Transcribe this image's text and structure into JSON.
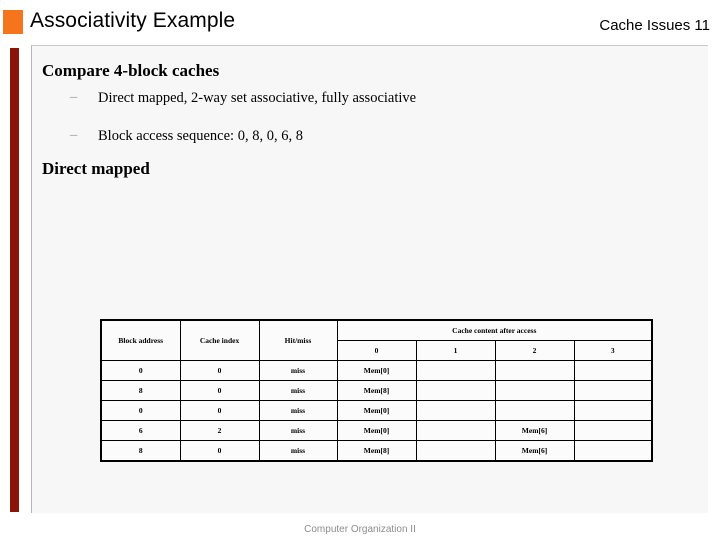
{
  "header": {
    "title": "Associativity Example",
    "right_label": "Cache Issues 11",
    "accent_color": "#f4751b",
    "bar_color": "#8a1408"
  },
  "body": {
    "heading_1": "Compare 4-block caches",
    "bullets": [
      {
        "marker": "–",
        "text": "Direct mapped, 2-way set associative, fully associative"
      },
      {
        "marker": "–",
        "text": "Block access sequence: 0, 8, 0, 6, 8"
      }
    ],
    "heading_2": "Direct mapped"
  },
  "table": {
    "headers": {
      "block_address": "Block address",
      "cache_index": "Cache index",
      "hit_miss": "Hit/miss",
      "cache_content": "Cache content after access"
    },
    "subheaders": [
      "0",
      "1",
      "2",
      "3"
    ],
    "rows": [
      {
        "block_address": "0",
        "cache_index": "0",
        "hit_miss": "miss",
        "content": [
          {
            "text": "Mem[0]",
            "style": "mem-gray"
          },
          {
            "text": "",
            "style": "cell-empty"
          },
          {
            "text": "",
            "style": "cell-empty"
          },
          {
            "text": "",
            "style": "cell-empty"
          }
        ]
      },
      {
        "block_address": "8",
        "cache_index": "0",
        "hit_miss": "miss",
        "content": [
          {
            "text": "Mem[8]",
            "style": "mem-red"
          },
          {
            "text": "",
            "style": "cell-empty"
          },
          {
            "text": "",
            "style": "cell-empty"
          },
          {
            "text": "",
            "style": "cell-empty"
          }
        ]
      },
      {
        "block_address": "0",
        "cache_index": "0",
        "hit_miss": "miss",
        "content": [
          {
            "text": "Mem[0]",
            "style": "mem-red"
          },
          {
            "text": "",
            "style": "cell-empty"
          },
          {
            "text": "",
            "style": "cell-empty"
          },
          {
            "text": "",
            "style": "cell-empty"
          }
        ]
      },
      {
        "block_address": "6",
        "cache_index": "2",
        "hit_miss": "miss",
        "content": [
          {
            "text": "Mem[0]",
            "style": "mem-black"
          },
          {
            "text": "",
            "style": "cell-empty"
          },
          {
            "text": "Mem[6]",
            "style": "mem-gray"
          },
          {
            "text": "",
            "style": "cell-empty"
          }
        ]
      },
      {
        "block_address": "8",
        "cache_index": "0",
        "hit_miss": "miss",
        "content": [
          {
            "text": "Mem[8]",
            "style": "mem-red"
          },
          {
            "text": "",
            "style": "cell-empty"
          },
          {
            "text": "Mem[6]",
            "style": "mem-black"
          },
          {
            "text": "",
            "style": "cell-empty"
          }
        ]
      }
    ]
  },
  "footer": {
    "text": "Computer Organization II"
  }
}
